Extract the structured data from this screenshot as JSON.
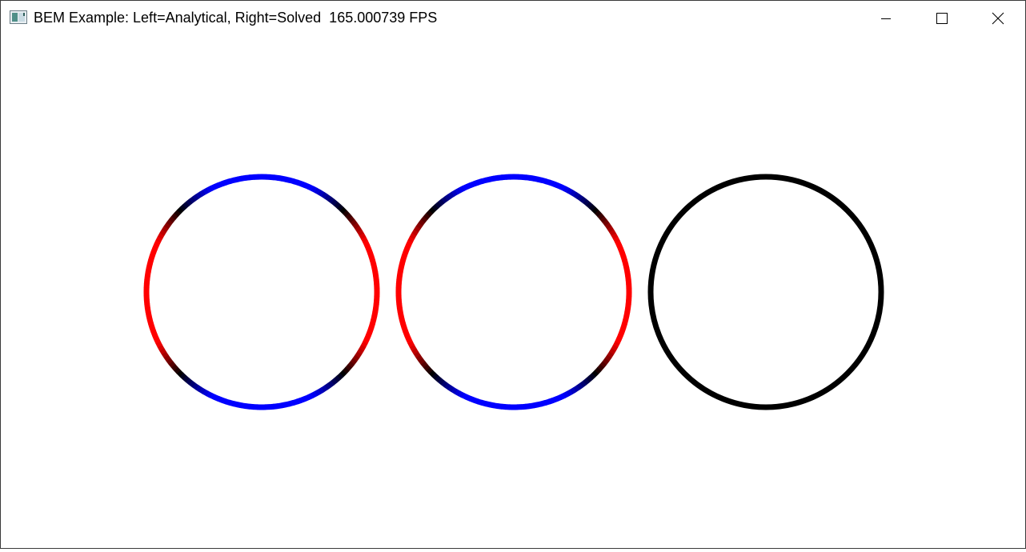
{
  "window": {
    "title": "BEM Example: Left=Analytical, Right=Solved  165.000739 FPS",
    "controls": {
      "minimize_icon": "minimize-icon",
      "maximize_icon": "maximize-icon",
      "close_icon": "close-icon"
    }
  },
  "scene": {
    "circles": [
      {
        "name": "analytical-ring",
        "coloring": "gradient",
        "colors": {
          "top_bottom": "#0000ff",
          "sides": "#ff0000",
          "transition": "#000000"
        }
      },
      {
        "name": "solved-ring",
        "coloring": "gradient",
        "colors": {
          "top_bottom": "#0000ff",
          "sides": "#ff0000",
          "transition": "#000000"
        }
      },
      {
        "name": "boundary-ring",
        "coloring": "solid",
        "colors": {
          "stroke": "#000000"
        }
      }
    ]
  }
}
